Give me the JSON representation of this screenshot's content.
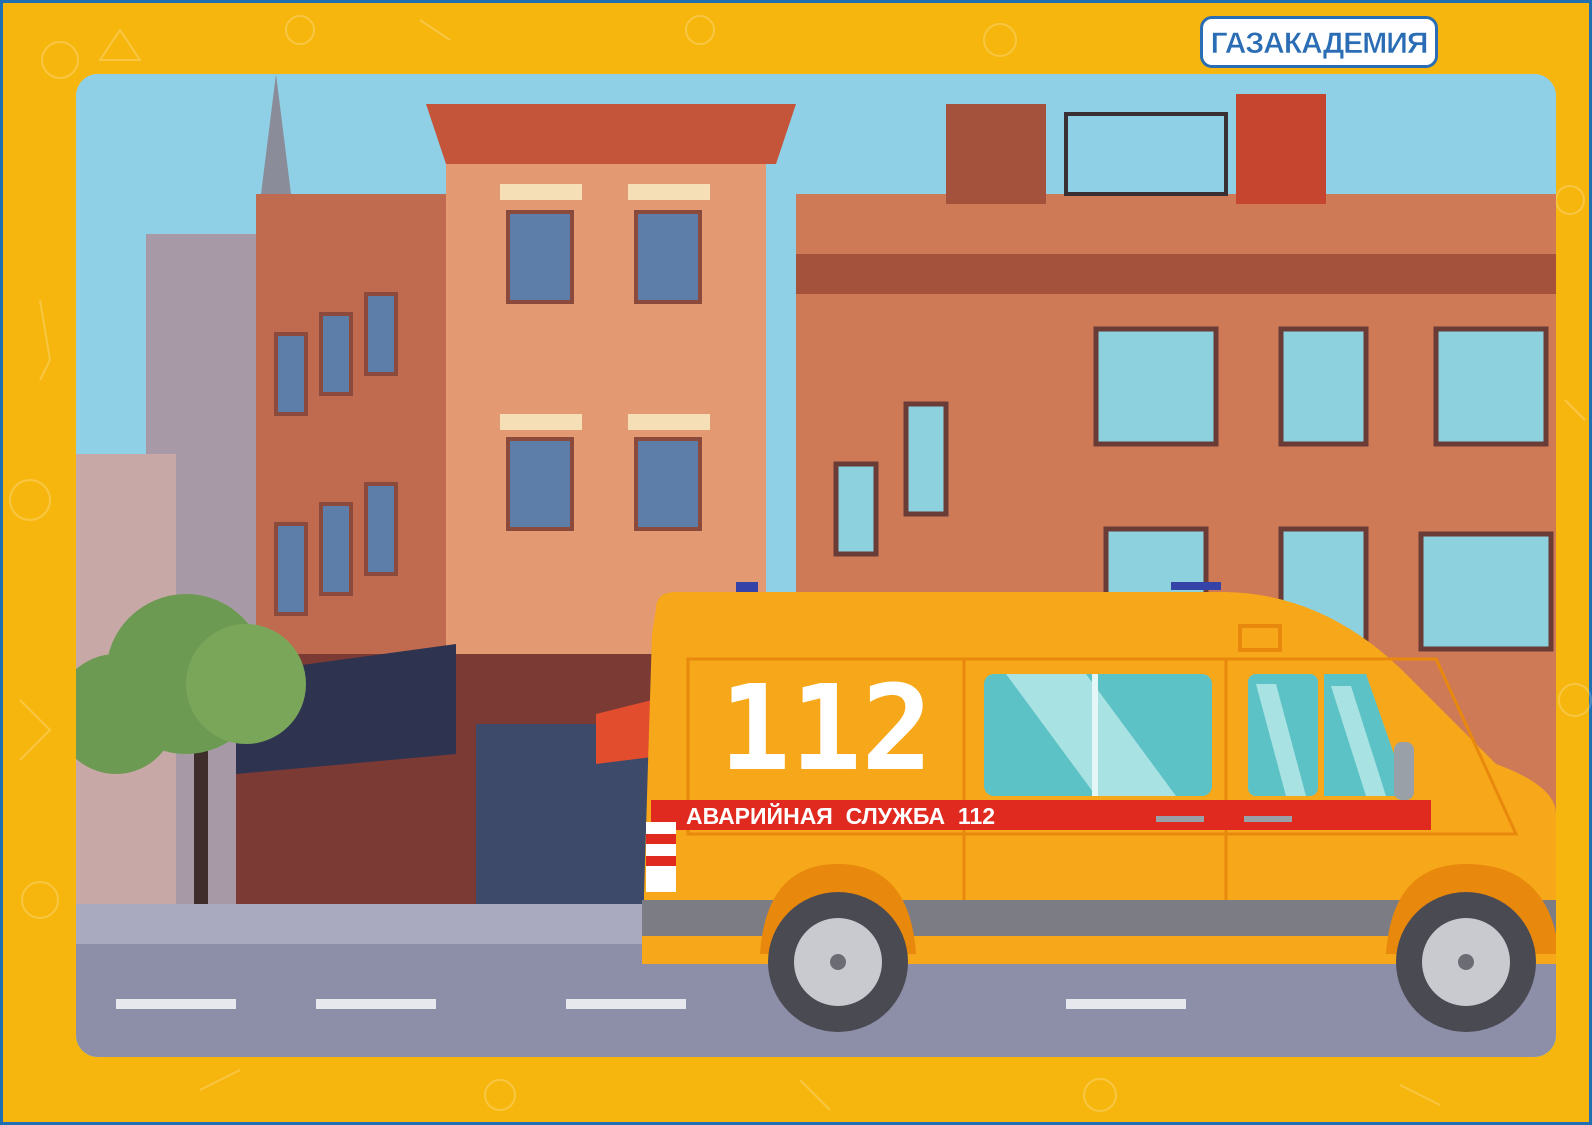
{
  "brand": {
    "logo_text": "ГАЗАКАДЕМИЯ"
  },
  "vehicle": {
    "big_number": "112",
    "stripe_text": "АВАРИЙНАЯ  СЛУЖБА  112",
    "body_color": "#f6a81a",
    "stripe_color": "#e02a20"
  },
  "colors": {
    "border_yellow": "#f6b60d",
    "frame_blue": "#1f6fb2",
    "sky": "#8fd0e6"
  }
}
